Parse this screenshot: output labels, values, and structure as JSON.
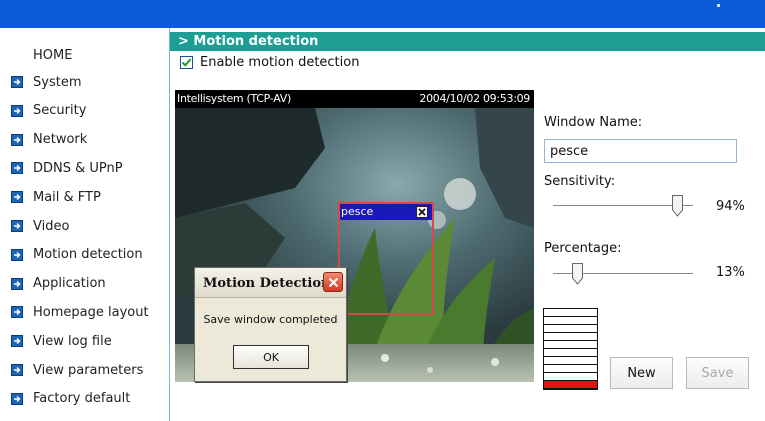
{
  "sidebar": {
    "home": "HOME",
    "items": [
      {
        "label": "System"
      },
      {
        "label": "Security"
      },
      {
        "label": "Network"
      },
      {
        "label": "DDNS & UPnP"
      },
      {
        "label": "Mail & FTP"
      },
      {
        "label": "Video"
      },
      {
        "label": "Motion detection"
      },
      {
        "label": "Application"
      },
      {
        "label": "Homepage layout"
      },
      {
        "label": "View log file"
      },
      {
        "label": "View parameters"
      },
      {
        "label": "Factory default"
      }
    ]
  },
  "header": {
    "title": "> Motion detection",
    "enable_label": "Enable motion detection",
    "enabled": true
  },
  "video": {
    "camera_name": "Intellisystem (TCP-AV)",
    "timestamp": "2004/10/02 09:53:09"
  },
  "motion_window": {
    "title": "pesce"
  },
  "dialog": {
    "title": "Motion Detection",
    "message": "Save window completed",
    "ok_label": "OK"
  },
  "settings": {
    "window_name_label": "Window Name:",
    "window_name_value": "pesce",
    "sensitivity_label": "Sensitivity:",
    "sensitivity_value": 94,
    "sensitivity_text": "94%",
    "percentage_label": "Percentage:",
    "percentage_value": 13,
    "percentage_text": "13%",
    "meter_active_fraction": 0.13
  },
  "buttons": {
    "new_label": "New",
    "save_label": "Save"
  },
  "colors": {
    "topbar": "#0a5bd8",
    "header_bar": "#1d9e95",
    "meter_active": "#e01212",
    "motion_window_border": "#d24a4a"
  }
}
